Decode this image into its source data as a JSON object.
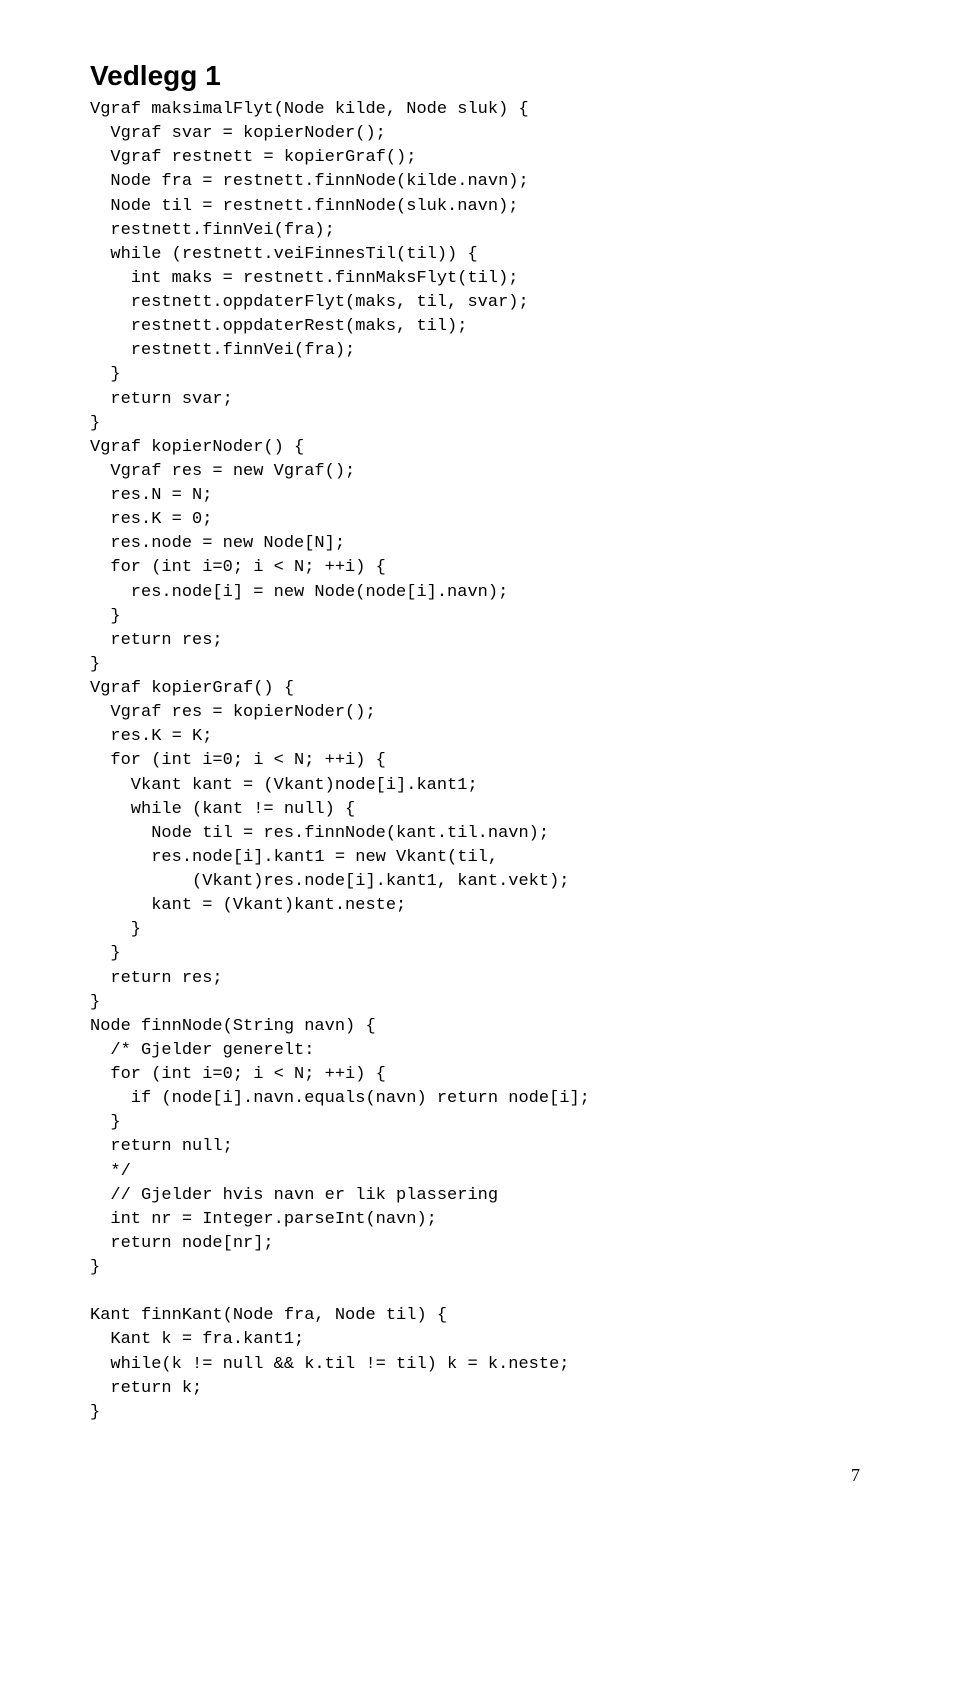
{
  "heading": "Vedlegg 1",
  "code": "Vgraf maksimalFlyt(Node kilde, Node sluk) {\n  Vgraf svar = kopierNoder();\n  Vgraf restnett = kopierGraf();\n  Node fra = restnett.finnNode(kilde.navn);\n  Node til = restnett.finnNode(sluk.navn);\n  restnett.finnVei(fra);\n  while (restnett.veiFinnesTil(til)) {\n    int maks = restnett.finnMaksFlyt(til);\n    restnett.oppdaterFlyt(maks, til, svar);\n    restnett.oppdaterRest(maks, til);\n    restnett.finnVei(fra);\n  }\n  return svar;\n}\nVgraf kopierNoder() {\n  Vgraf res = new Vgraf();\n  res.N = N;\n  res.K = 0;\n  res.node = new Node[N];\n  for (int i=0; i < N; ++i) {\n    res.node[i] = new Node(node[i].navn);\n  }\n  return res;\n}\nVgraf kopierGraf() {\n  Vgraf res = kopierNoder();\n  res.K = K;\n  for (int i=0; i < N; ++i) {\n    Vkant kant = (Vkant)node[i].kant1;\n    while (kant != null) {\n      Node til = res.finnNode(kant.til.navn);\n      res.node[i].kant1 = new Vkant(til,\n          (Vkant)res.node[i].kant1, kant.vekt);\n      kant = (Vkant)kant.neste;\n    }\n  }\n  return res;\n}\nNode finnNode(String navn) {\n  /* Gjelder generelt:\n  for (int i=0; i < N; ++i) {\n    if (node[i].navn.equals(navn) return node[i];\n  }\n  return null;\n  */\n  // Gjelder hvis navn er lik plassering\n  int nr = Integer.parseInt(navn);\n  return node[nr];\n}\n\nKant finnKant(Node fra, Node til) {\n  Kant k = fra.kant1;\n  while(k != null && k.til != til) k = k.neste;\n  return k;\n}",
  "page_number": "7"
}
